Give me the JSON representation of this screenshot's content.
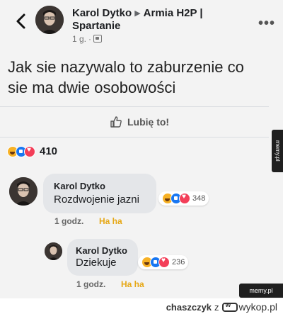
{
  "post": {
    "author": "Karol Dytko",
    "group_line1": "Armia H2P |",
    "group_line2": "Spartanie",
    "time": "1 g.",
    "text": "Jak sie nazywalo to zaburzenie co sie ma dwie osobowości",
    "like_label": "Lubię to!",
    "reaction_count": "410",
    "icons": {
      "back": "chevron-left-icon",
      "more": "more-horizontal-icon",
      "audience": "friends-icon",
      "like": "thumbs-up-icon"
    }
  },
  "comments": [
    {
      "author": "Karol Dytko",
      "text": "Rozdwojenie jazni",
      "reaction_count": "348",
      "time": "1 godz.",
      "reaction_label": "Ha ha"
    },
    {
      "author": "Karol Dytko",
      "text": "Dziekuje",
      "reaction_count": "236",
      "time": "1 godz.",
      "reaction_label": "Ha ha"
    }
  ],
  "watermark": {
    "side": "memy.pl",
    "badge": "memy.pl",
    "credit_user": "chaszczyk",
    "credit_sep": "z",
    "credit_site": "wykop.pl"
  },
  "colors": {
    "haha": "#f7b125",
    "like": "#1877f2",
    "love": "#f33e58",
    "bubble": "#e4e6e9"
  }
}
